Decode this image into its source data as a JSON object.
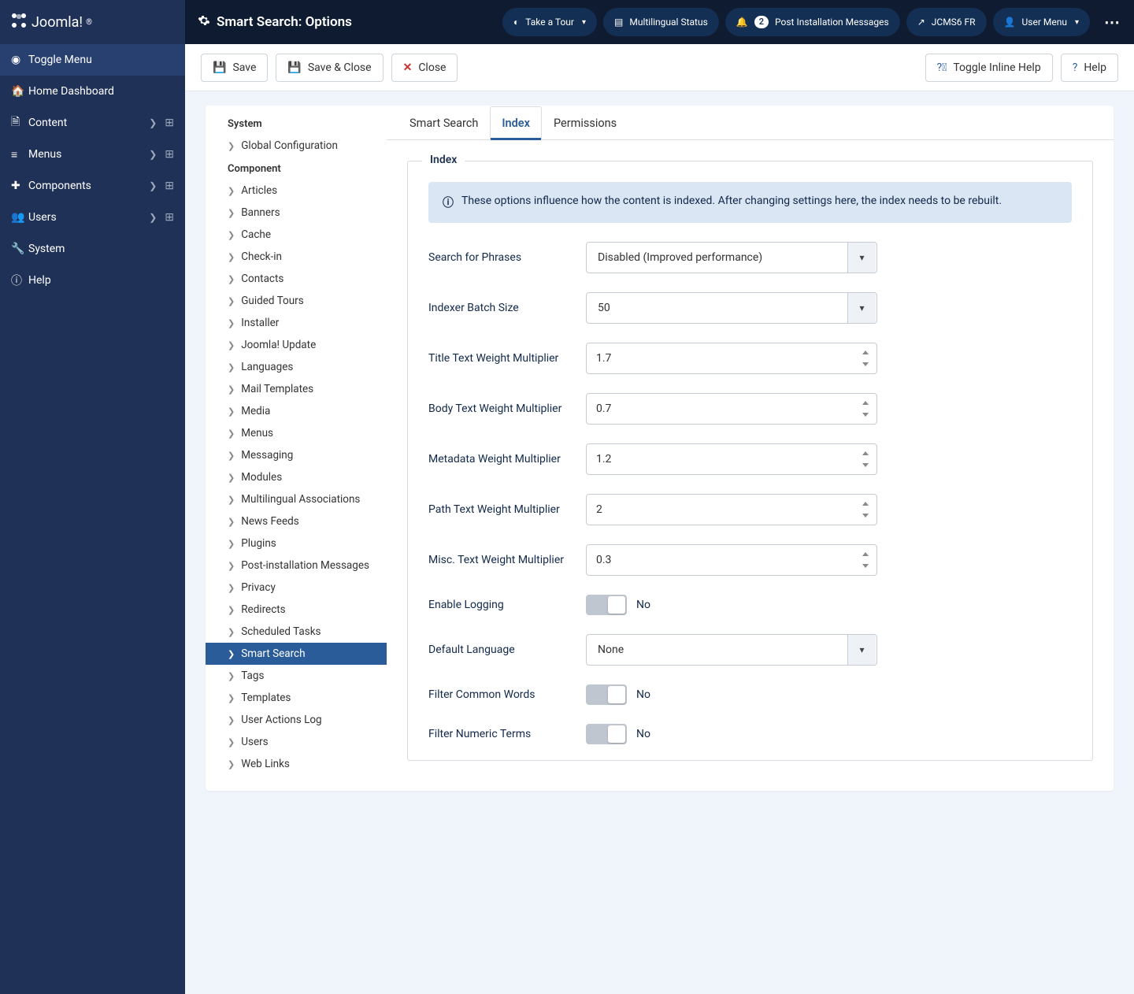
{
  "topbar": {
    "brand": "Joomla!",
    "title": "Smart Search: Options",
    "pills": {
      "tour": "Take a Tour",
      "multilingual": "Multilingual Status",
      "postinstall_count": "2",
      "postinstall": "Post Installation Messages",
      "lang": "JCMS6 FR",
      "usermenu": "User Menu"
    }
  },
  "sidebar": {
    "toggle": "Toggle Menu",
    "items": [
      {
        "label": "Home Dashboard",
        "icon": "home",
        "expandable": false
      },
      {
        "label": "Content",
        "icon": "file",
        "expandable": true
      },
      {
        "label": "Menus",
        "icon": "list",
        "expandable": true
      },
      {
        "label": "Components",
        "icon": "puzzle",
        "expandable": true
      },
      {
        "label": "Users",
        "icon": "users",
        "expandable": true
      },
      {
        "label": "System",
        "icon": "wrench",
        "expandable": false
      },
      {
        "label": "Help",
        "icon": "info",
        "expandable": false
      }
    ]
  },
  "toolbar": {
    "save": "Save",
    "save_close": "Save & Close",
    "close": "Close",
    "inline_help": "Toggle Inline Help",
    "help": "Help"
  },
  "tree": {
    "system_heading": "System",
    "system_items": [
      "Global Configuration"
    ],
    "component_heading": "Component",
    "component_items": [
      "Articles",
      "Banners",
      "Cache",
      "Check-in",
      "Contacts",
      "Guided Tours",
      "Installer",
      "Joomla! Update",
      "Languages",
      "Mail Templates",
      "Media",
      "Menus",
      "Messaging",
      "Modules",
      "Multilingual Associations",
      "News Feeds",
      "Plugins",
      "Post-installation Messages",
      "Privacy",
      "Redirects",
      "Scheduled Tasks",
      "Smart Search",
      "Tags",
      "Templates",
      "User Actions Log",
      "Users",
      "Web Links"
    ],
    "active": "Smart Search"
  },
  "tabs": [
    "Smart Search",
    "Index",
    "Permissions"
  ],
  "active_tab": "Index",
  "fieldset": {
    "legend": "Index",
    "info": "These options influence how the content is indexed. After changing settings here, the index needs to be rebuilt.",
    "fields": {
      "search_phrases": {
        "label": "Search for Phrases",
        "value": "Disabled (Improved performance)",
        "type": "select"
      },
      "batch_size": {
        "label": "Indexer Batch Size",
        "value": "50",
        "type": "select"
      },
      "title_weight": {
        "label": "Title Text Weight Multiplier",
        "value": "1.7",
        "type": "number"
      },
      "body_weight": {
        "label": "Body Text Weight Multiplier",
        "value": "0.7",
        "type": "number"
      },
      "meta_weight": {
        "label": "Metadata Weight Multiplier",
        "value": "1.2",
        "type": "number"
      },
      "path_weight": {
        "label": "Path Text Weight Multiplier",
        "value": "2",
        "type": "number"
      },
      "misc_weight": {
        "label": "Misc. Text Weight Multiplier",
        "value": "0.3",
        "type": "number"
      },
      "logging": {
        "label": "Enable Logging",
        "value": "No",
        "type": "switch"
      },
      "default_lang": {
        "label": "Default Language",
        "value": "None",
        "type": "select"
      },
      "filter_common": {
        "label": "Filter Common Words",
        "value": "No",
        "type": "switch"
      },
      "filter_numeric": {
        "label": "Filter Numeric Terms",
        "value": "No",
        "type": "switch"
      }
    }
  }
}
